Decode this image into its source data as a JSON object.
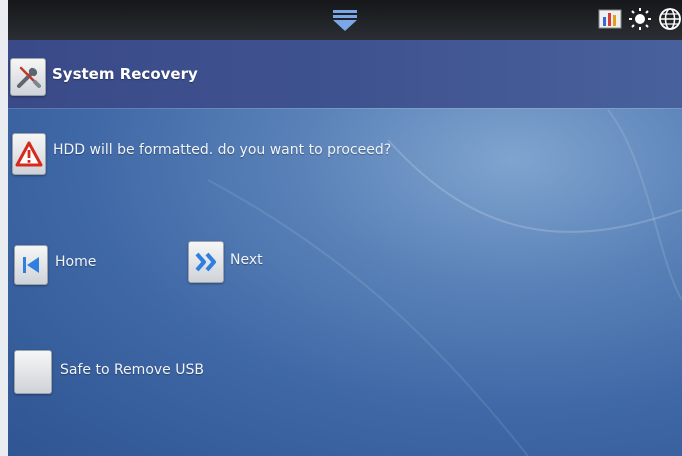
{
  "header": {
    "title": "System Recovery"
  },
  "status_icons": [
    "bar-chart-icon",
    "brightness-icon",
    "globe-icon"
  ],
  "message": {
    "text": "HDD will be formatted. do you want to proceed?",
    "icon": "warning-icon"
  },
  "actions": {
    "home_label": "Home",
    "next_label": "Next",
    "usb_label": "Safe to Remove USB"
  },
  "colors": {
    "title_bar": "#3f5290",
    "background": "#4a74b0",
    "warning": "#d62a1e",
    "nav_arrow": "#2f7fe0"
  }
}
